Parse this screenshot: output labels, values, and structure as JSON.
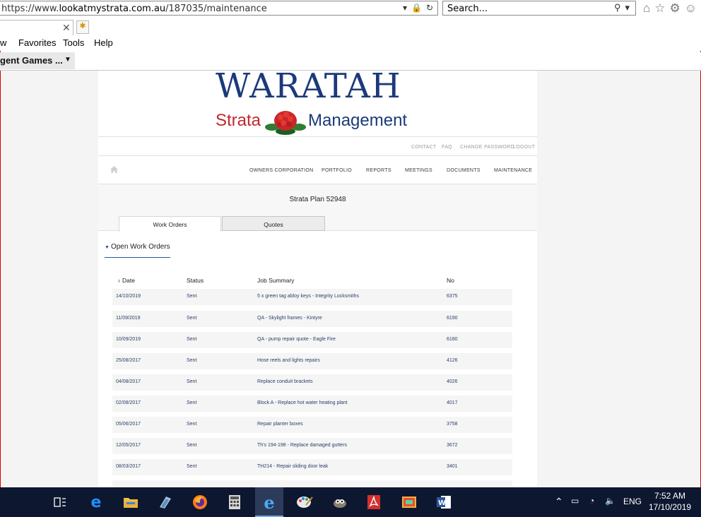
{
  "browser": {
    "url_prefix": "https://www.",
    "url_host": "lookatmystrata.com.au",
    "url_path": "/187035/maintenance",
    "search_placeholder": "Search...",
    "menu": [
      "w",
      "Favorites",
      "Tools",
      "Help"
    ],
    "favorites_item": "gent Games ..."
  },
  "logo": {
    "title": "WARATAH",
    "sub_left": "Strata",
    "sub_right": "Management"
  },
  "util_links": [
    "CONTACT",
    "FAQ",
    "CHANGE PASSWORD",
    "LOGOUT"
  ],
  "nav_links": [
    "OWNERS CORPORATION",
    "PORTFOLIO",
    "REPORTS",
    "MEETINGS",
    "DOCUMENTS",
    "MAINTENANCE"
  ],
  "plan_title": "Strata Plan 52948",
  "tabs": [
    {
      "label": "Work Orders",
      "active": true
    },
    {
      "label": "Quotes",
      "active": false
    }
  ],
  "section_title": "Open Work Orders",
  "table": {
    "headers": [
      "Date",
      "Status",
      "Job Summary",
      "No"
    ],
    "rows": [
      {
        "date": "14/10/2019",
        "status": "Sent",
        "summary": "5 x green tag abloy keys - Integrity Locksmiths",
        "no": "6375"
      },
      {
        "date": "11/09/2019",
        "status": "Sent",
        "summary": "QA - Skylight frames - Kintyre",
        "no": "6190"
      },
      {
        "date": "10/09/2019",
        "status": "Sent",
        "summary": "QA - pump repair quote - Eagle Fire",
        "no": "6180"
      },
      {
        "date": "25/08/2017",
        "status": "Sent",
        "summary": "Hose reels and lights repairs",
        "no": "4126"
      },
      {
        "date": "04/08/2017",
        "status": "Sent",
        "summary": "Replace conduit brackets",
        "no": "4026"
      },
      {
        "date": "02/08/2017",
        "status": "Sent",
        "summary": "Block A - Replace hot water heating plant",
        "no": "4017"
      },
      {
        "date": "05/06/2017",
        "status": "Sent",
        "summary": "Repair planter boxes",
        "no": "3758"
      },
      {
        "date": "12/05/2017",
        "status": "Sent",
        "summary": "Th's 194-198 - Replace damaged gutters",
        "no": "3672"
      },
      {
        "date": "08/03/2017",
        "status": "Sent",
        "summary": "TH214 - Repair sliding door leak",
        "no": "3401"
      }
    ]
  },
  "taskbar": {
    "lang": "ENG",
    "time": "7:52 AM",
    "date": "17/10/2019"
  },
  "colors": {
    "brand_blue": "#1b3a7a",
    "brand_red": "#c0282d",
    "taskbar": "#0e1730"
  }
}
